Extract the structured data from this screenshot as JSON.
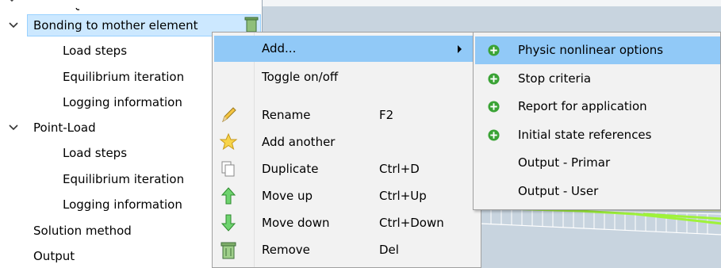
{
  "tree": {
    "items": [
      {
        "label": "Bonding to mother element",
        "level": 0,
        "expanded": true,
        "selected": true
      },
      {
        "label": "Load steps",
        "level": 1
      },
      {
        "label": "Equilibrium iteration",
        "level": 1
      },
      {
        "label": "Logging information",
        "level": 1
      },
      {
        "label": "Point-Load",
        "level": 0,
        "expanded": true
      },
      {
        "label": "Load steps",
        "level": 1
      },
      {
        "label": "Equilibrium iteration",
        "level": 1
      },
      {
        "label": "Logging information",
        "level": 1
      },
      {
        "label": "Solution method",
        "level": 0
      },
      {
        "label": "Output",
        "level": 0
      }
    ]
  },
  "context_menu": {
    "items": [
      {
        "label": "Add...",
        "shortcut": "",
        "icon": "none",
        "submenu": true,
        "highlighted": true
      },
      {
        "label": "Toggle on/off",
        "shortcut": "",
        "icon": "none"
      },
      {
        "label": "Rename",
        "shortcut": "F2",
        "icon": "pencil-icon"
      },
      {
        "label": "Add another",
        "shortcut": "",
        "icon": "star-icon"
      },
      {
        "label": "Duplicate",
        "shortcut": "Ctrl+D",
        "icon": "duplicate-icon"
      },
      {
        "label": "Move up",
        "shortcut": "Ctrl+Up",
        "icon": "arrow-up-icon"
      },
      {
        "label": "Move down",
        "shortcut": "Ctrl+Down",
        "icon": "arrow-down-icon"
      },
      {
        "label": "Remove",
        "shortcut": "Del",
        "icon": "trash-icon"
      }
    ]
  },
  "submenu": {
    "items": [
      {
        "label": "Physic nonlinear options",
        "icon": "plus-circle-icon",
        "highlighted": true
      },
      {
        "label": "Stop criteria",
        "icon": "plus-circle-icon"
      },
      {
        "label": "Report for application",
        "icon": "plus-circle-icon"
      },
      {
        "label": "Initial state references",
        "icon": "plus-circle-icon"
      },
      {
        "label": "Output - Primar",
        "icon": "none"
      },
      {
        "label": "Output - User",
        "icon": "none"
      }
    ]
  },
  "colors": {
    "selection": "#cce8ff",
    "menu_highlight": "#91c9f7",
    "menu_bg": "#f2f2f2",
    "plus_icon": "#3aa335",
    "viewport_bg": "#c7d3de",
    "mesh_line": "#9ff23a"
  }
}
